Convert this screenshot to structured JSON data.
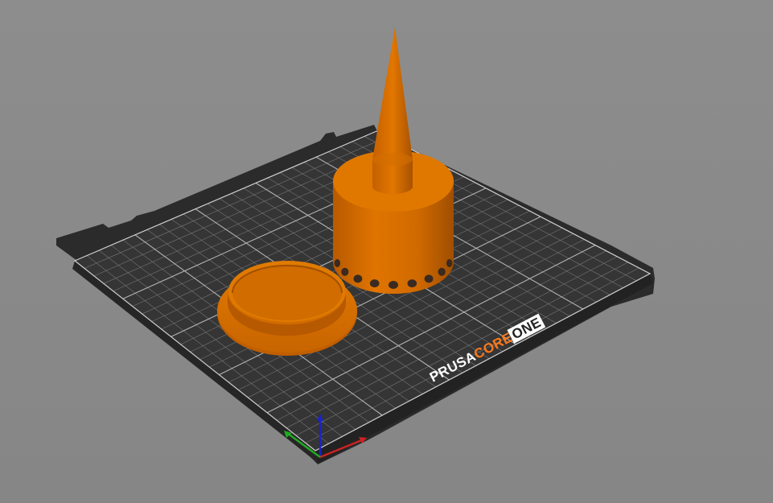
{
  "viewport": {
    "background": "#8b8b8b"
  },
  "bed": {
    "brand_word_1": "PRUSA",
    "brand_word_2": "CORE",
    "brand_word_3": "ONE",
    "plate_color": "#2f2f2f",
    "grid_color": "#9a9a9a",
    "brand_accent": "#ff7a1a"
  },
  "objects": [
    {
      "name": "cone-on-perforated-cylinder",
      "color": "#d96b00"
    },
    {
      "name": "round-lid",
      "color": "#d96b00"
    }
  ],
  "axes": {
    "x_color": "#cc2222",
    "y_color": "#22aa22",
    "z_color": "#1a22c8"
  }
}
